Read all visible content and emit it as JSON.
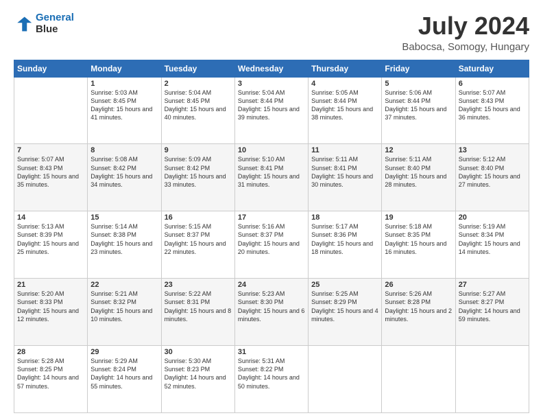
{
  "header": {
    "logo_line1": "General",
    "logo_line2": "Blue",
    "title": "July 2024",
    "subtitle": "Babocsa, Somogy, Hungary"
  },
  "calendar": {
    "days_of_week": [
      "Sunday",
      "Monday",
      "Tuesday",
      "Wednesday",
      "Thursday",
      "Friday",
      "Saturday"
    ],
    "weeks": [
      [
        {
          "day": "",
          "sunrise": "",
          "sunset": "",
          "daylight": "",
          "empty": true
        },
        {
          "day": "1",
          "sunrise": "Sunrise: 5:03 AM",
          "sunset": "Sunset: 8:45 PM",
          "daylight": "Daylight: 15 hours and 41 minutes."
        },
        {
          "day": "2",
          "sunrise": "Sunrise: 5:04 AM",
          "sunset": "Sunset: 8:45 PM",
          "daylight": "Daylight: 15 hours and 40 minutes."
        },
        {
          "day": "3",
          "sunrise": "Sunrise: 5:04 AM",
          "sunset": "Sunset: 8:44 PM",
          "daylight": "Daylight: 15 hours and 39 minutes."
        },
        {
          "day": "4",
          "sunrise": "Sunrise: 5:05 AM",
          "sunset": "Sunset: 8:44 PM",
          "daylight": "Daylight: 15 hours and 38 minutes."
        },
        {
          "day": "5",
          "sunrise": "Sunrise: 5:06 AM",
          "sunset": "Sunset: 8:44 PM",
          "daylight": "Daylight: 15 hours and 37 minutes."
        },
        {
          "day": "6",
          "sunrise": "Sunrise: 5:07 AM",
          "sunset": "Sunset: 8:43 PM",
          "daylight": "Daylight: 15 hours and 36 minutes."
        }
      ],
      [
        {
          "day": "7",
          "sunrise": "Sunrise: 5:07 AM",
          "sunset": "Sunset: 8:43 PM",
          "daylight": "Daylight: 15 hours and 35 minutes."
        },
        {
          "day": "8",
          "sunrise": "Sunrise: 5:08 AM",
          "sunset": "Sunset: 8:42 PM",
          "daylight": "Daylight: 15 hours and 34 minutes."
        },
        {
          "day": "9",
          "sunrise": "Sunrise: 5:09 AM",
          "sunset": "Sunset: 8:42 PM",
          "daylight": "Daylight: 15 hours and 33 minutes."
        },
        {
          "day": "10",
          "sunrise": "Sunrise: 5:10 AM",
          "sunset": "Sunset: 8:41 PM",
          "daylight": "Daylight: 15 hours and 31 minutes."
        },
        {
          "day": "11",
          "sunrise": "Sunrise: 5:11 AM",
          "sunset": "Sunset: 8:41 PM",
          "daylight": "Daylight: 15 hours and 30 minutes."
        },
        {
          "day": "12",
          "sunrise": "Sunrise: 5:11 AM",
          "sunset": "Sunset: 8:40 PM",
          "daylight": "Daylight: 15 hours and 28 minutes."
        },
        {
          "day": "13",
          "sunrise": "Sunrise: 5:12 AM",
          "sunset": "Sunset: 8:40 PM",
          "daylight": "Daylight: 15 hours and 27 minutes."
        }
      ],
      [
        {
          "day": "14",
          "sunrise": "Sunrise: 5:13 AM",
          "sunset": "Sunset: 8:39 PM",
          "daylight": "Daylight: 15 hours and 25 minutes."
        },
        {
          "day": "15",
          "sunrise": "Sunrise: 5:14 AM",
          "sunset": "Sunset: 8:38 PM",
          "daylight": "Daylight: 15 hours and 23 minutes."
        },
        {
          "day": "16",
          "sunrise": "Sunrise: 5:15 AM",
          "sunset": "Sunset: 8:37 PM",
          "daylight": "Daylight: 15 hours and 22 minutes."
        },
        {
          "day": "17",
          "sunrise": "Sunrise: 5:16 AM",
          "sunset": "Sunset: 8:37 PM",
          "daylight": "Daylight: 15 hours and 20 minutes."
        },
        {
          "day": "18",
          "sunrise": "Sunrise: 5:17 AM",
          "sunset": "Sunset: 8:36 PM",
          "daylight": "Daylight: 15 hours and 18 minutes."
        },
        {
          "day": "19",
          "sunrise": "Sunrise: 5:18 AM",
          "sunset": "Sunset: 8:35 PM",
          "daylight": "Daylight: 15 hours and 16 minutes."
        },
        {
          "day": "20",
          "sunrise": "Sunrise: 5:19 AM",
          "sunset": "Sunset: 8:34 PM",
          "daylight": "Daylight: 15 hours and 14 minutes."
        }
      ],
      [
        {
          "day": "21",
          "sunrise": "Sunrise: 5:20 AM",
          "sunset": "Sunset: 8:33 PM",
          "daylight": "Daylight: 15 hours and 12 minutes."
        },
        {
          "day": "22",
          "sunrise": "Sunrise: 5:21 AM",
          "sunset": "Sunset: 8:32 PM",
          "daylight": "Daylight: 15 hours and 10 minutes."
        },
        {
          "day": "23",
          "sunrise": "Sunrise: 5:22 AM",
          "sunset": "Sunset: 8:31 PM",
          "daylight": "Daylight: 15 hours and 8 minutes."
        },
        {
          "day": "24",
          "sunrise": "Sunrise: 5:23 AM",
          "sunset": "Sunset: 8:30 PM",
          "daylight": "Daylight: 15 hours and 6 minutes."
        },
        {
          "day": "25",
          "sunrise": "Sunrise: 5:25 AM",
          "sunset": "Sunset: 8:29 PM",
          "daylight": "Daylight: 15 hours and 4 minutes."
        },
        {
          "day": "26",
          "sunrise": "Sunrise: 5:26 AM",
          "sunset": "Sunset: 8:28 PM",
          "daylight": "Daylight: 15 hours and 2 minutes."
        },
        {
          "day": "27",
          "sunrise": "Sunrise: 5:27 AM",
          "sunset": "Sunset: 8:27 PM",
          "daylight": "Daylight: 14 hours and 59 minutes."
        }
      ],
      [
        {
          "day": "28",
          "sunrise": "Sunrise: 5:28 AM",
          "sunset": "Sunset: 8:25 PM",
          "daylight": "Daylight: 14 hours and 57 minutes."
        },
        {
          "day": "29",
          "sunrise": "Sunrise: 5:29 AM",
          "sunset": "Sunset: 8:24 PM",
          "daylight": "Daylight: 14 hours and 55 minutes."
        },
        {
          "day": "30",
          "sunrise": "Sunrise: 5:30 AM",
          "sunset": "Sunset: 8:23 PM",
          "daylight": "Daylight: 14 hours and 52 minutes."
        },
        {
          "day": "31",
          "sunrise": "Sunrise: 5:31 AM",
          "sunset": "Sunset: 8:22 PM",
          "daylight": "Daylight: 14 hours and 50 minutes."
        },
        {
          "day": "",
          "empty": true
        },
        {
          "day": "",
          "empty": true
        },
        {
          "day": "",
          "empty": true
        }
      ]
    ]
  }
}
